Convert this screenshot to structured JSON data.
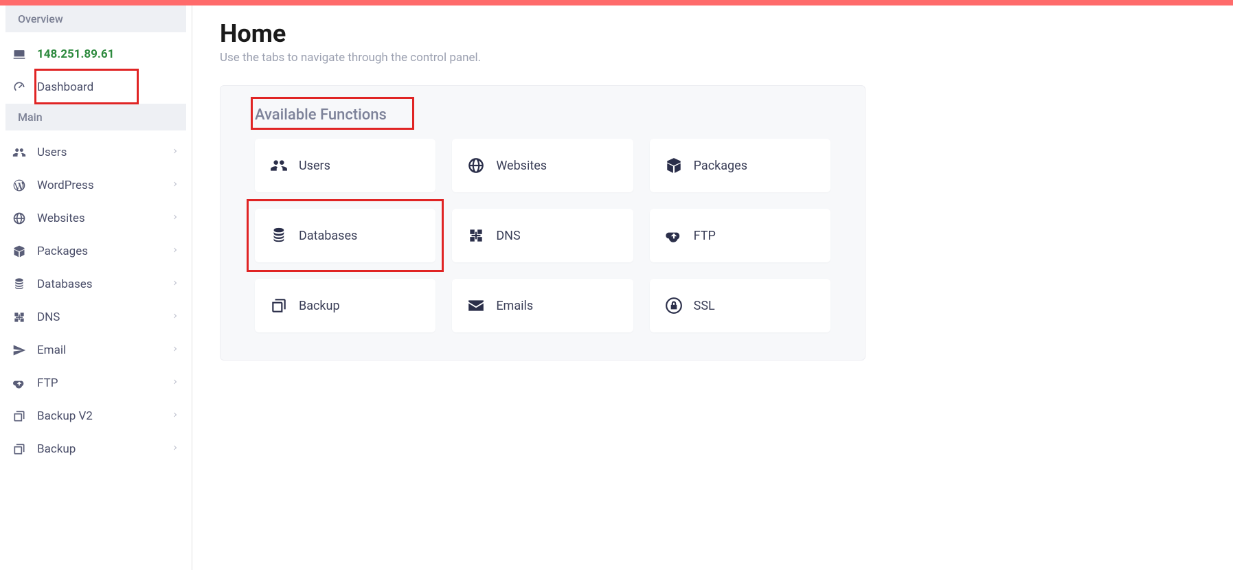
{
  "sidebar": {
    "sections": [
      {
        "header": "Overview",
        "items": [
          {
            "icon": "laptop",
            "label": "148.251.89.61",
            "kind": "ip",
            "expandable": false
          },
          {
            "icon": "dashboard",
            "label": "Dashboard",
            "kind": "link",
            "expandable": false
          }
        ]
      },
      {
        "header": "Main",
        "items": [
          {
            "icon": "users",
            "label": "Users",
            "expandable": true
          },
          {
            "icon": "wordpress",
            "label": "WordPress",
            "expandable": true
          },
          {
            "icon": "globe",
            "label": "Websites",
            "expandable": true
          },
          {
            "icon": "packages",
            "label": "Packages",
            "expandable": true
          },
          {
            "icon": "database",
            "label": "Databases",
            "expandable": true
          },
          {
            "icon": "dns",
            "label": "DNS",
            "expandable": true
          },
          {
            "icon": "email",
            "label": "Email",
            "expandable": true
          },
          {
            "icon": "ftp",
            "label": "FTP",
            "expandable": true
          },
          {
            "icon": "backup",
            "label": "Backup V2",
            "expandable": true
          },
          {
            "icon": "backup",
            "label": "Backup",
            "expandable": true
          }
        ]
      }
    ]
  },
  "page": {
    "title": "Home",
    "subtitle": "Use the tabs to navigate through the control panel."
  },
  "panel": {
    "title": "Available Functions",
    "cards": [
      {
        "icon": "users",
        "label": "Users"
      },
      {
        "icon": "globe",
        "label": "Websites"
      },
      {
        "icon": "packages",
        "label": "Packages"
      },
      {
        "icon": "database",
        "label": "Databases"
      },
      {
        "icon": "dns",
        "label": "DNS"
      },
      {
        "icon": "ftp",
        "label": "FTP"
      },
      {
        "icon": "backup",
        "label": "Backup"
      },
      {
        "icon": "envelope",
        "label": "Emails"
      },
      {
        "icon": "ssl",
        "label": "SSL"
      }
    ]
  },
  "highlights": {
    "dashboard": true,
    "available_functions_title": true,
    "databases_card": true
  }
}
